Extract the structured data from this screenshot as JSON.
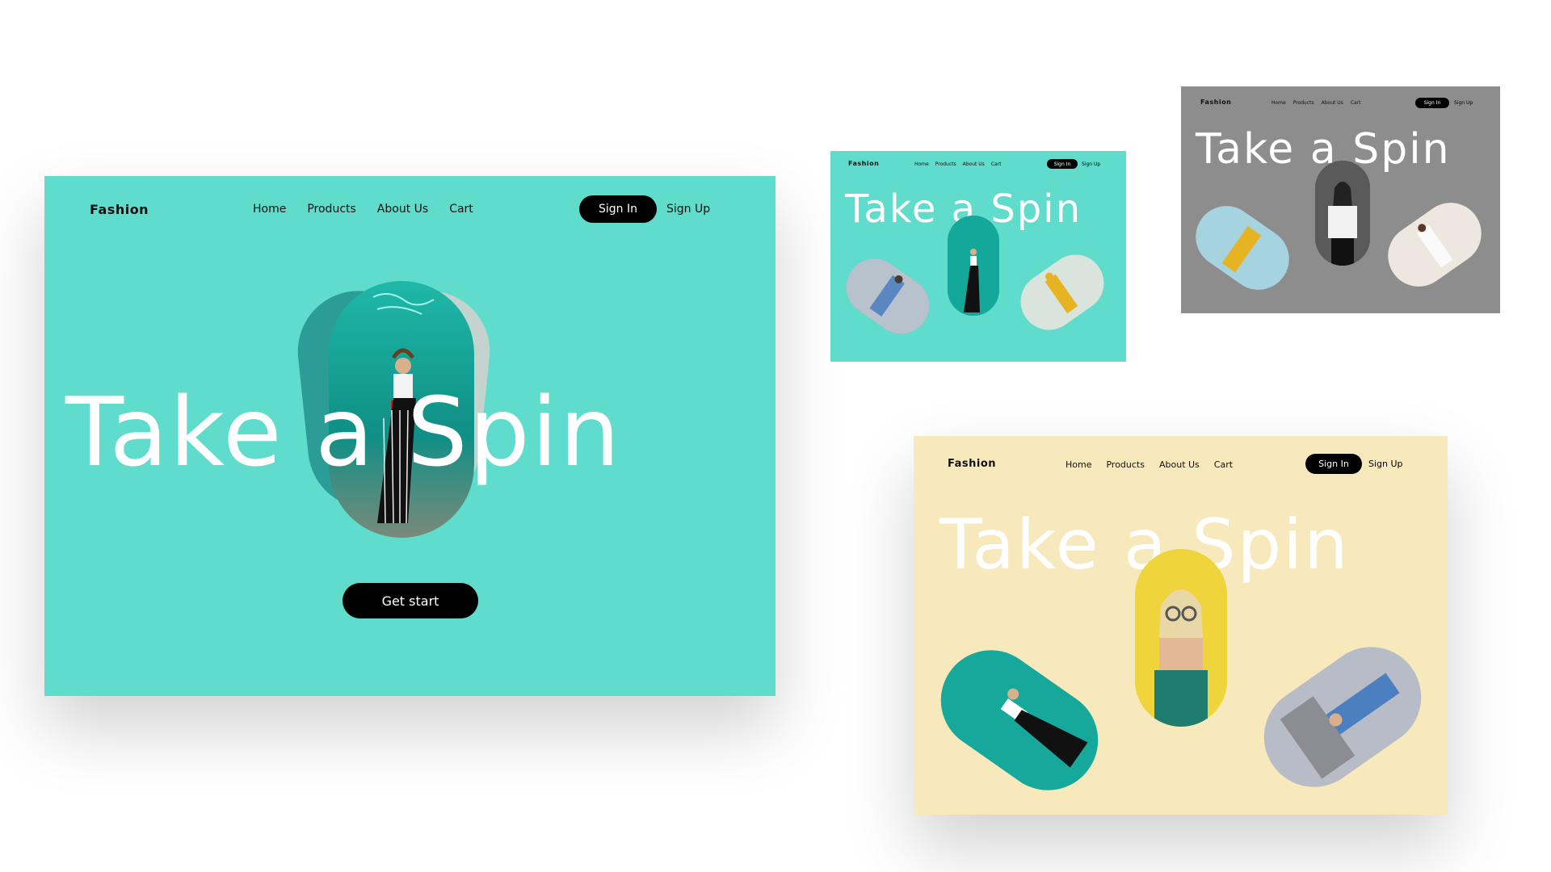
{
  "colors": {
    "teal": "#5fdccb",
    "grey": "#8d8d8d",
    "cream": "#f7e9bb",
    "black": "#000000",
    "white": "#ffffff"
  },
  "brand": "Fashion",
  "nav": {
    "home": "Home",
    "products": "Products",
    "about": "About Us",
    "cart": "Cart"
  },
  "auth": {
    "sign_in": "Sign In",
    "sign_up": "Sign Up"
  },
  "hero": {
    "title": "Take a Spin",
    "cta": "Get start"
  }
}
